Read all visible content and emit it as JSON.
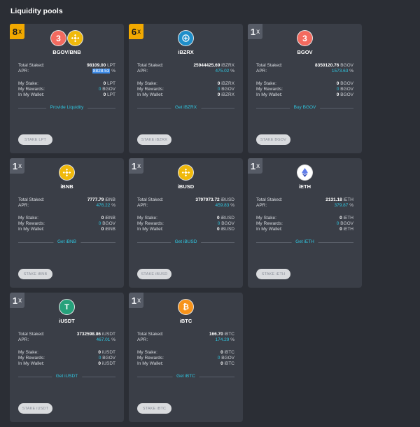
{
  "page": {
    "title": "Liquidity pools"
  },
  "labels": {
    "total_staked": "Total Staked:",
    "apr": "APR:",
    "my_stake": "My Stake:",
    "my_rewards": "My Rewards:",
    "in_my_wallet": "In My Wallet:",
    "reward_token": "BGOV",
    "multiplier_suffix": "x"
  },
  "colors": {
    "accent_cyan": "#2fc6e0",
    "hot_badge": "#f2a900",
    "card_bg": "#3a3e47",
    "page_bg": "#2b2e35"
  },
  "pools": [
    {
      "id": "bgov-bnb",
      "multiplier": "8",
      "hot": true,
      "name": "BGOV/BNB",
      "icons": [
        "bgov-icon",
        "bnb-icon"
      ],
      "token": "LPT",
      "total_staked": "98109.00",
      "apr": "8828.53",
      "apr_unit": "%",
      "apr_selected": true,
      "my_stake": "0",
      "my_rewards": "0",
      "in_wallet": "0",
      "link_text": "Provide Liquidity",
      "stake_label": "STAKE LPT"
    },
    {
      "id": "ibzrx",
      "multiplier": "6",
      "hot": true,
      "name": "iBZRX",
      "icons": [
        "bzrx-icon"
      ],
      "token": "iBZRX",
      "total_staked": "25944425.69",
      "apr": "475.02",
      "apr_unit": "%",
      "apr_selected": false,
      "my_stake": "0",
      "my_rewards": "0",
      "in_wallet": "0",
      "link_text": "Get iBZRX",
      "stake_label": "STAKE iBZRX"
    },
    {
      "id": "bgov",
      "multiplier": "1",
      "hot": false,
      "name": "BGOV",
      "icons": [
        "bgov-icon"
      ],
      "token": "BGOV",
      "total_staked": "8350120.76",
      "apr": "1573.63",
      "apr_unit": "%",
      "apr_selected": false,
      "my_stake": "0",
      "my_rewards": "0",
      "in_wallet": "0",
      "link_text": "Buy BGOV",
      "stake_label": "STAKE BGOV"
    },
    {
      "id": "ibnb",
      "multiplier": "1",
      "hot": false,
      "name": "iBNB",
      "icons": [
        "bnb-icon"
      ],
      "token": "iBNB",
      "total_staked": "7777.79",
      "apr": "476.22",
      "apr_unit": "%",
      "apr_selected": false,
      "my_stake": "0",
      "my_rewards": "0",
      "in_wallet": "0",
      "link_text": "Get iBNB",
      "stake_label": "STAKE iBNB"
    },
    {
      "id": "ibusd",
      "multiplier": "1",
      "hot": false,
      "name": "iBUSD",
      "icons": [
        "busd-icon"
      ],
      "token": "iBUSD",
      "total_staked": "3797073.72",
      "apr": "459.83",
      "apr_unit": "%",
      "apr_selected": false,
      "my_stake": "0",
      "my_rewards": "0",
      "in_wallet": "0",
      "link_text": "Get iBUSD",
      "stake_label": "STAKE iBUSD"
    },
    {
      "id": "ieth",
      "multiplier": "1",
      "hot": false,
      "name": "iETH",
      "icons": [
        "eth-icon"
      ],
      "token": "iETH",
      "total_staked": "2131.18",
      "apr": "379.87",
      "apr_unit": "%",
      "apr_selected": false,
      "my_stake": "0",
      "my_rewards": "0",
      "in_wallet": "0",
      "link_text": "Get iETH",
      "stake_label": "STAKE iETH"
    },
    {
      "id": "iusdt",
      "multiplier": "1",
      "hot": false,
      "name": "iUSDT",
      "icons": [
        "usdt-icon"
      ],
      "token": "iUSDT",
      "total_staked": "3732598.86",
      "apr": "467.01",
      "apr_unit": "%",
      "apr_selected": false,
      "my_stake": "0",
      "my_rewards": "0",
      "in_wallet": "0",
      "link_text": "Get iUSDT",
      "stake_label": "STAKE iUSDT"
    },
    {
      "id": "ibtc",
      "multiplier": "1",
      "hot": false,
      "name": "iBTC",
      "icons": [
        "btc-icon"
      ],
      "token": "iBTC",
      "total_staked": "166.70",
      "apr": "174.29",
      "apr_unit": "%",
      "apr_selected": false,
      "my_stake": "0",
      "my_rewards": "0",
      "in_wallet": "0",
      "link_text": "Get iBTC",
      "stake_label": "STAKE iBTC"
    }
  ]
}
